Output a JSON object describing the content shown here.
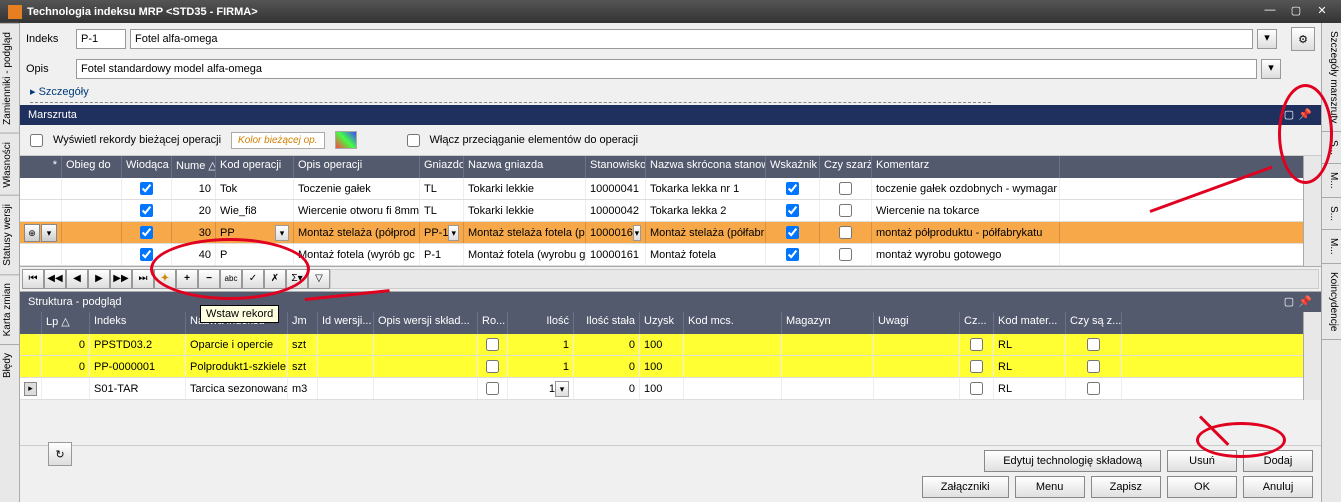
{
  "title": "Technologia indeksu MRP <STD35 - FIRMA>",
  "form": {
    "indeks_label": "Indeks",
    "indeks_code": "P-1",
    "indeks_name": "Fotel alfa-omega",
    "opis_label": "Opis",
    "opis_value": "Fotel standardowy model alfa-omega",
    "szczegoly": "Szczegóły"
  },
  "left_tabs": [
    "Zamienniki - podgląd",
    "Własności",
    "Statusy wersji",
    "Karta zmian",
    "Błędy"
  ],
  "right_tabs": [
    "Szczegóły marszruty",
    "S...",
    "M...",
    "S...",
    "M...",
    "Koincydencje"
  ],
  "marszruta": {
    "title": "Marszruta",
    "opt1": "Wyświetl rekordy bieżącej operacji",
    "opt_color": "Kolor bieżącej op.",
    "opt2": "Włącz przeciąganie elementów do operacji",
    "cols": [
      "Obieg do",
      "Wiodąca",
      "Nume △",
      "Kod operacji",
      "Opis operacji",
      "Gniazdo",
      "Nazwa gniazda",
      "Stanowisko",
      "Nazwa skrócona stanow",
      "Wskaźnik",
      "Czy szarżo",
      "Komentarz"
    ],
    "rows": [
      {
        "sel": false,
        "wiod": true,
        "num": "10",
        "kod": "Tok",
        "opis": "Toczenie gałek",
        "gn": "TL",
        "ngn": "Tokarki lekkie",
        "st": "10000041",
        "nst": "Tokarka lekka nr 1",
        "wsk": true,
        "sz": false,
        "kom": "toczenie gałek ozdobnych - wymagar"
      },
      {
        "sel": false,
        "wiod": true,
        "num": "20",
        "kod": "Wie_fi8",
        "opis": "Wiercenie otworu fi 8mm",
        "gn": "TL",
        "ngn": "Tokarki lekkie",
        "st": "10000042",
        "nst": "Tokarka lekka 2",
        "wsk": true,
        "sz": false,
        "kom": "Wiercenie na tokarce"
      },
      {
        "sel": true,
        "wiod": true,
        "num": "30",
        "kod": "PP",
        "opis": "Montaż stelaża (półprod",
        "gn": "PP-1",
        "ngn": "Montaż stelaża fotela (p",
        "st": "1000016",
        "nst": "Montaż stelaża (półfabr",
        "wsk": true,
        "sz": false,
        "kom": "montaż półproduktu - półfabrykatu"
      },
      {
        "sel": false,
        "wiod": true,
        "num": "40",
        "kod": "P",
        "opis": "Montaż fotela (wyrób gc",
        "gn": "P-1",
        "ngn": "Montaż fotela (wyrobu g",
        "st": "10000161",
        "nst": "Montaż fotela",
        "wsk": true,
        "sz": false,
        "kom": "montaż wyrobu gotowego"
      }
    ]
  },
  "tooltip": "Wstaw rekord",
  "struktura": {
    "title": "Struktura - podgląd",
    "cols": [
      "Lp △",
      "Indeks",
      "Nazwa indeksu",
      "Jm",
      "Id wersji...",
      "Opis wersji skład...",
      "Ro...",
      "Ilość",
      "Ilość stała",
      "Uzysk",
      "Kod mcs.",
      "Magazyn",
      "Uwagi",
      "Cz...",
      "Kod mater...",
      "Czy są z..."
    ],
    "rows": [
      {
        "yellow": true,
        "lp": "0",
        "idx": "PPSTD03.2",
        "nazwa": "Oparcie i opercie",
        "jm": "szt",
        "ro": false,
        "il": "1",
        "ist": "0",
        "uz": "100",
        "cz": false,
        "kmat": "RL",
        "csz": false
      },
      {
        "yellow": true,
        "lp": "0",
        "idx": "PP-0000001",
        "nazwa": "Polprodukt1-szkiele",
        "jm": "szt",
        "ro": false,
        "il": "1",
        "ist": "0",
        "uz": "100",
        "cz": false,
        "kmat": "RL",
        "csz": false
      },
      {
        "yellow": false,
        "lp": "",
        "idx": "S01-TAR",
        "nazwa": "Tarcica sezonowana",
        "jm": "m3",
        "ro": false,
        "il": "1",
        "ist": "0",
        "uz": "100",
        "cz": false,
        "kmat": "RL",
        "csz": false
      }
    ]
  },
  "buttons": {
    "edit_tech": "Edytuj technologię składową",
    "usun": "Usuń",
    "dodaj": "Dodaj",
    "zalaczniki": "Załączniki",
    "menu": "Menu",
    "zapisz": "Zapisz",
    "ok": "OK",
    "anuluj": "Anuluj"
  }
}
